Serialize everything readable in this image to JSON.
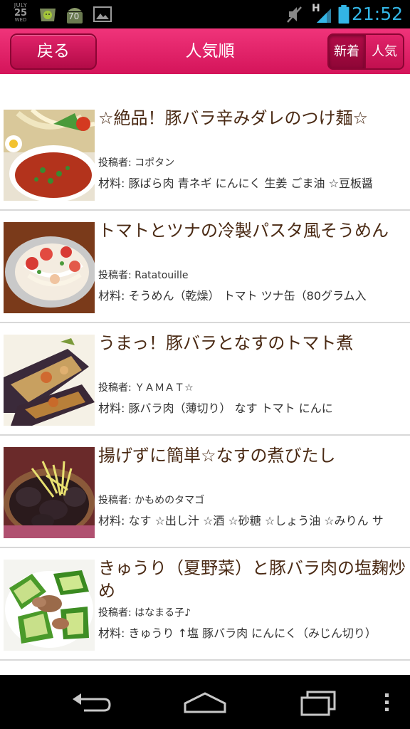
{
  "status_bar": {
    "date_month": "JULY",
    "date_day": "25",
    "date_weekday": "WED",
    "battery_notification": "70",
    "network_type": "H",
    "time": "21:52",
    "notification_icons": [
      "android-market-icon",
      "android-battery-icon",
      "gallery-icon"
    ],
    "system_icons": [
      "mute-icon",
      "signal-icon",
      "battery-icon"
    ]
  },
  "header": {
    "back_label": "戻る",
    "title": "人気順",
    "sort_new_label": "新着",
    "sort_popular_label": "人気",
    "accent_color": "#e8206a"
  },
  "recipes": [
    {
      "title": "☆絶品！豚バラ辛みダレのつけ麺☆",
      "author_label": "投稿者: ",
      "author": "コポタン",
      "ingredients_label": "材料: ",
      "ingredients": "豚ばら肉 青ネギ にんにく 生姜 ごま油 ☆豆板醤",
      "thumbnail": "noodles-dipping-sauce"
    },
    {
      "title": "トマトとツナの冷製パスタ風そうめん",
      "author_label": "投稿者: ",
      "author": "Ratatouille",
      "ingredients_label": "材料: ",
      "ingredients": "そうめん（乾燥） トマト ツナ缶（80グラム入",
      "thumbnail": "tomato-somen"
    },
    {
      "title": "うまっ！豚バラとなすのトマト煮",
      "author_label": "投稿者: ",
      "author": "ＹＡＭＡＴ☆",
      "ingredients_label": "材料: ",
      "ingredients": "豚バラ肉（薄切り） なす トマト にんに",
      "thumbnail": "eggplant-pork-tomato"
    },
    {
      "title": "揚げずに簡単☆なすの煮びたし",
      "author_label": "投稿者: ",
      "author": "かもめのタマゴ",
      "ingredients_label": "材料: ",
      "ingredients": "なす ☆出し汁 ☆酒 ☆砂糖 ☆しょう油 ☆みりん サ",
      "thumbnail": "simmered-eggplant"
    },
    {
      "title": "きゅうり（夏野菜）と豚バラ肉の塩麹炒め",
      "author_label": "投稿者: ",
      "author": "はなまる子♪",
      "ingredients_label": "材料: ",
      "ingredients": "きゅうり ↑塩 豚バラ肉 にんにく（みじん切り）",
      "thumbnail": "cucumber-pork-stirfry"
    }
  ],
  "nav_bar": {
    "buttons": [
      "back-icon",
      "home-icon",
      "recent-apps-icon",
      "menu-icon"
    ]
  }
}
